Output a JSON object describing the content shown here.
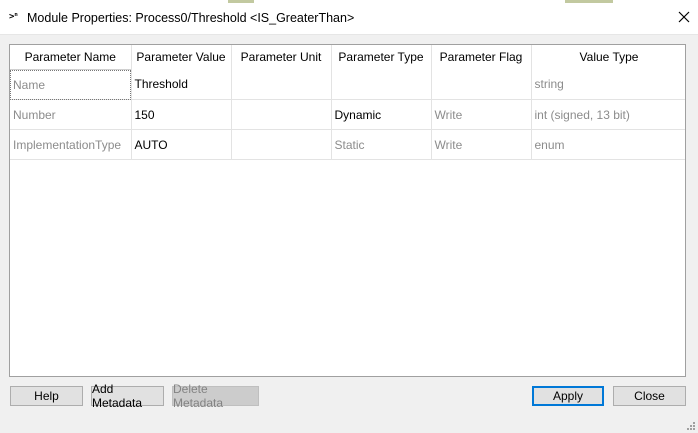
{
  "window": {
    "icon_glyph": ">ⁿ",
    "title": "Module Properties: Process0/Threshold <IS_GreaterThan>"
  },
  "table": {
    "columns": [
      "Parameter Name",
      "Parameter Value",
      "Parameter Unit",
      "Parameter Type",
      "Parameter Flag",
      "Value Type"
    ],
    "rows": [
      {
        "name": "Name",
        "value": "Threshold",
        "unit": "",
        "type": "",
        "flag": "",
        "value_type": "string"
      },
      {
        "name": "Number",
        "value": "150",
        "unit": "",
        "type": "Dynamic",
        "flag": "Write",
        "value_type": "int (signed, 13 bit)"
      },
      {
        "name": "ImplementationType",
        "value": "AUTO",
        "unit": "",
        "type": "Static",
        "flag": "Write",
        "value_type": "enum"
      }
    ]
  },
  "buttons": {
    "help": "Help",
    "add_metadata": "Add Metadata",
    "delete_metadata": "Delete Metadata",
    "apply": "Apply",
    "close": "Close"
  },
  "colors": {
    "window_bg": "#f0f0f0",
    "grid_line": "#e3e3e3",
    "disabled_text": "#8c8c8c",
    "accent": "#0078d7"
  }
}
